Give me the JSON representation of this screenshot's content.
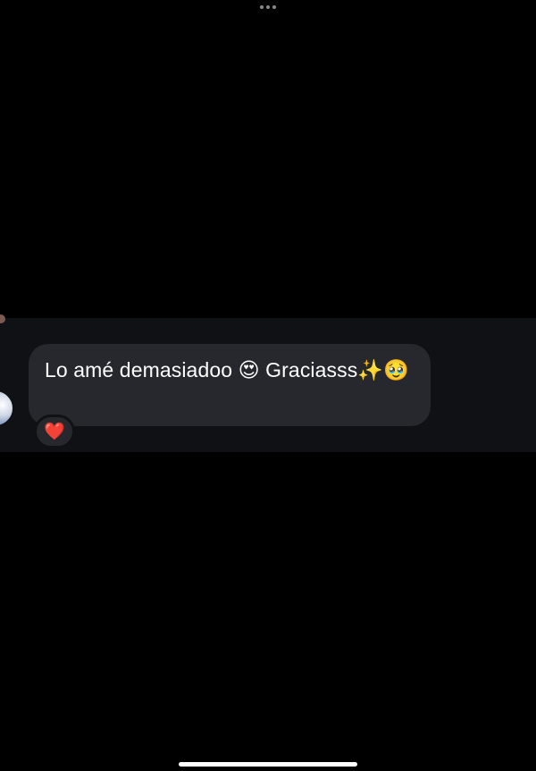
{
  "top_bar": {
    "more_icon": "ellipsis-icon"
  },
  "conversation": {
    "message": {
      "sender_avatar": "avatar",
      "text": "Lo amé demasiadoo 😍 Graciasss✨🥹",
      "reaction": "❤️"
    }
  },
  "system": {
    "home_indicator": "home-indicator"
  },
  "colors": {
    "background": "#000000",
    "strip": "#0f1114",
    "bubble": "#26282d",
    "text": "#ffffff"
  }
}
